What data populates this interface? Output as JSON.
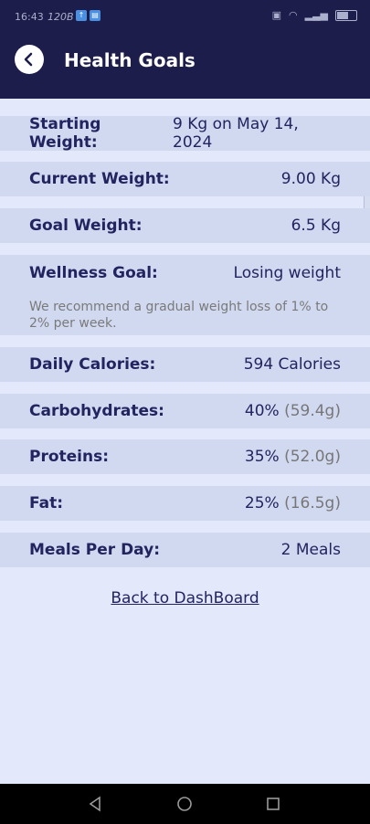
{
  "status_bar": {
    "time": "16:43",
    "speed": "120B"
  },
  "header": {
    "title": "Health Goals"
  },
  "rows": {
    "starting_weight": {
      "label": "Starting Weight:",
      "value": "9 Kg on May 14, 2024"
    },
    "current_weight": {
      "label": "Current Weight:",
      "value": "9.00 Kg"
    },
    "goal_weight": {
      "label": "Goal Weight:",
      "value": "6.5 Kg"
    },
    "wellness_goal": {
      "label": "Wellness Goal:",
      "value": "Losing weight",
      "note": "We recommend a gradual weight loss of 1% to 2% per week."
    },
    "daily_calories": {
      "label": "Daily Calories:",
      "value": "594 Calories"
    },
    "carbohydrates": {
      "label": "Carbohydrates:",
      "pct": "40%",
      "grams": "(59.4g)"
    },
    "proteins": {
      "label": "Proteins:",
      "pct": "35%",
      "grams": "(52.0g)"
    },
    "fat": {
      "label": "Fat:",
      "pct": "25%",
      "grams": "(16.5g)"
    },
    "meals_per_day": {
      "label": "Meals Per Day:",
      "value": "2 Meals"
    }
  },
  "links": {
    "back_to_dashboard": "Back to DashBoard"
  },
  "colors": {
    "header_bg": "#1d1d4c",
    "page_bg": "#e4e8fb",
    "row_bg": "#d1d9f0",
    "text": "#222460"
  }
}
